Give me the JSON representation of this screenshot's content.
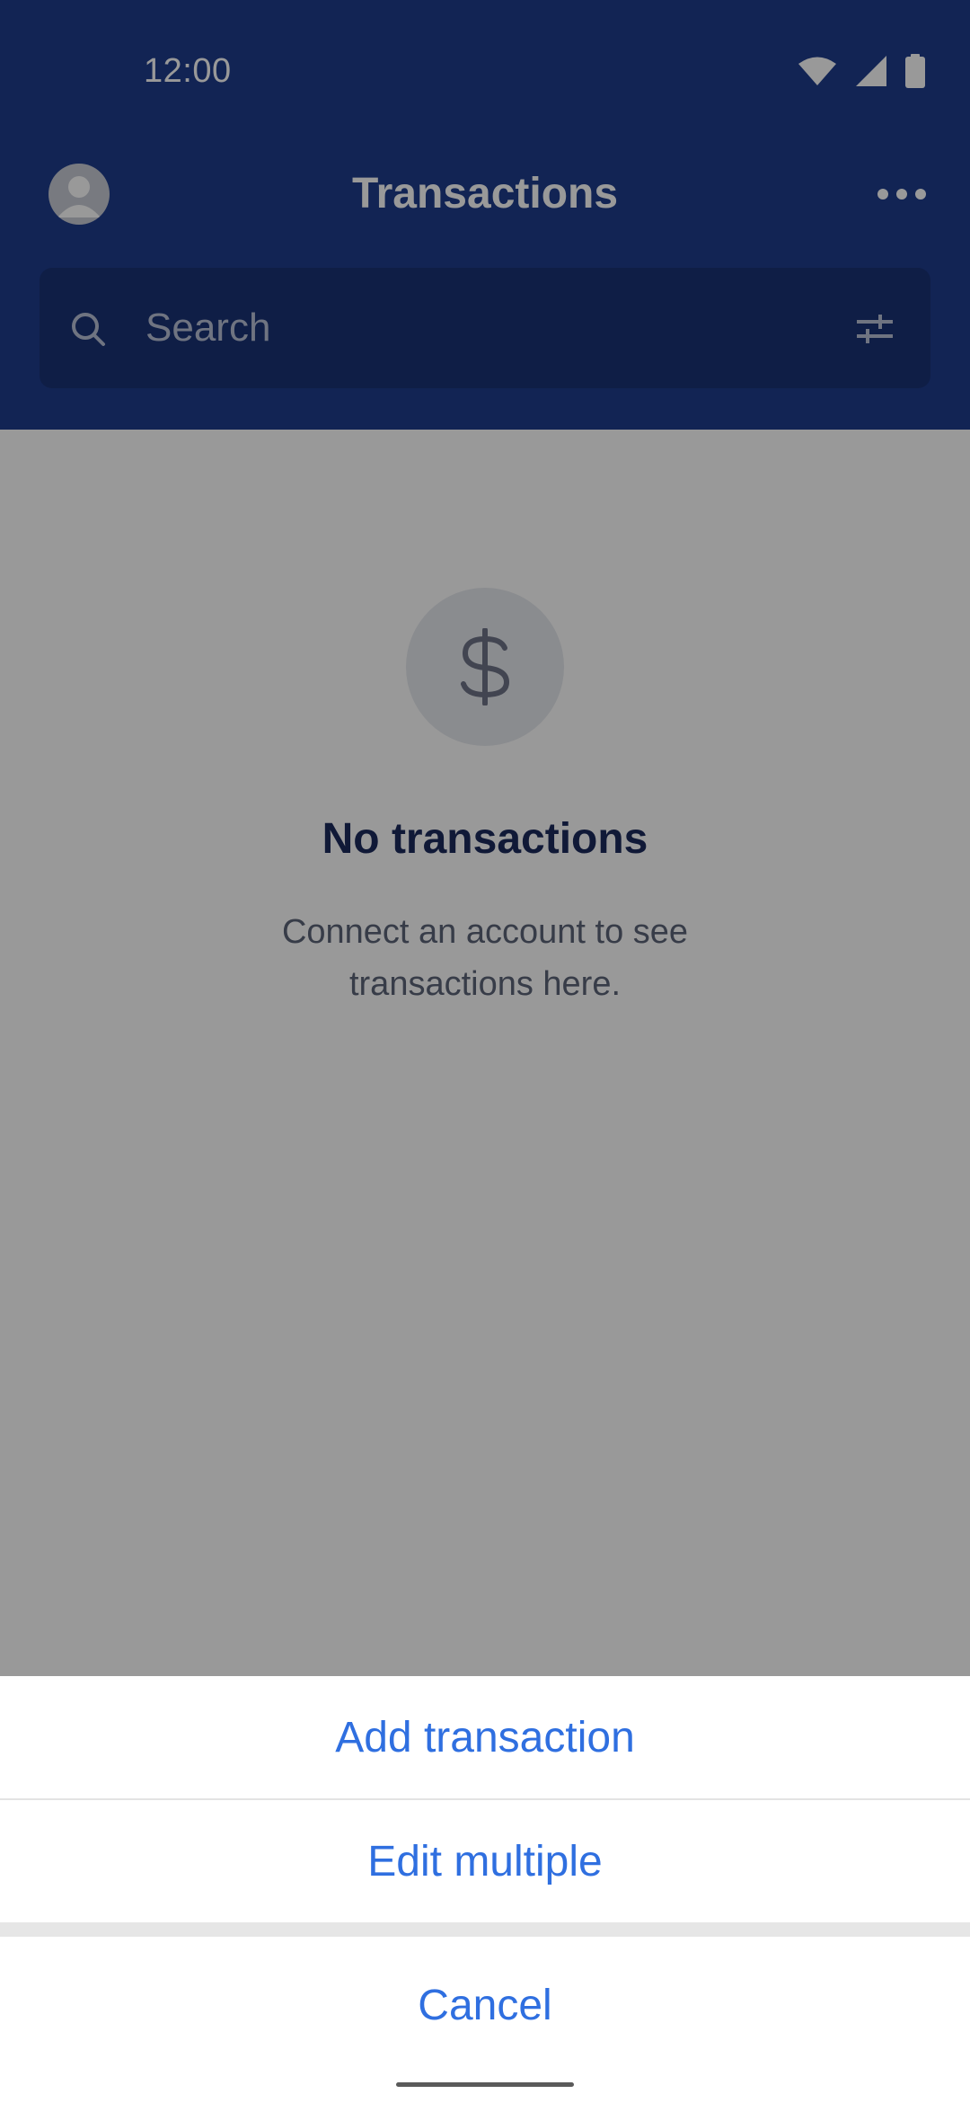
{
  "status_bar": {
    "time": "12:00",
    "icons": [
      "wifi-icon",
      "cellular-signal-icon",
      "battery-icon"
    ]
  },
  "header": {
    "title": "Transactions",
    "avatar_icon": "user-avatar-icon",
    "more_icon": "more-horizontal-icon"
  },
  "search": {
    "placeholder": "Search",
    "value": "",
    "filter_icon": "sliders-icon"
  },
  "empty_state": {
    "icon": "dollar-icon",
    "title": "No transactions",
    "description": "Connect an account to see transactions here."
  },
  "action_sheet": {
    "add_label": "Add transaction",
    "edit_label": "Edit multiple",
    "cancel_label": "Cancel"
  },
  "colors": {
    "header_bg": "#1e3c8c",
    "accent": "#2f6fe0",
    "title_dark": "#1c2a5c"
  }
}
